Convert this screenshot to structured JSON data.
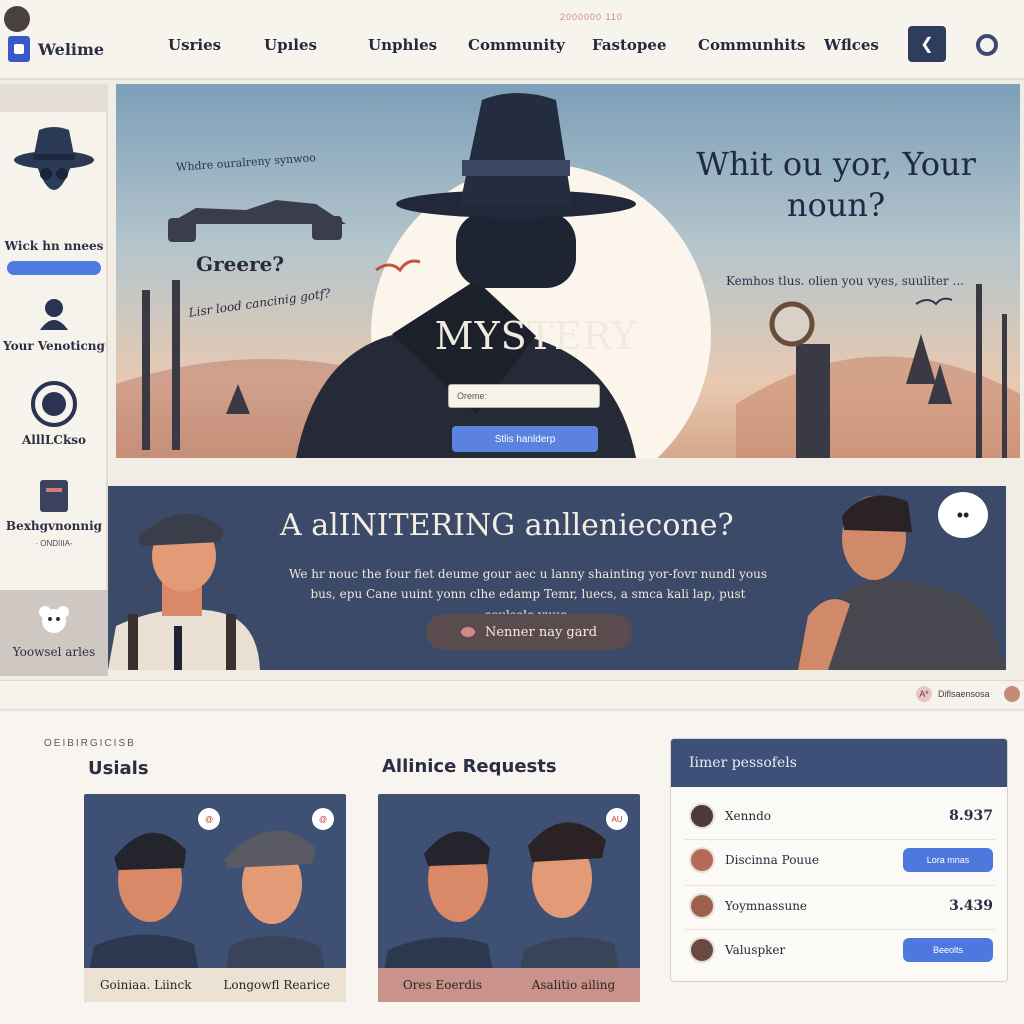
{
  "topbar": {
    "tiny_text": "2000000 110 ",
    "brand": "Welime",
    "links": [
      "Usries",
      "Upıles",
      "Unphles",
      "Community",
      "Fastopee",
      "Communhits",
      "Wflces"
    ],
    "action_icon": "chevron-left-icon",
    "globe_icon": "globe-icon"
  },
  "sidebar": {
    "items": [
      {
        "label": "Wick hn nnees",
        "icon": "detective-icon"
      },
      {
        "label": "Your Venoticng",
        "icon": "spy-icon"
      },
      {
        "label": "AlllLCkso",
        "icon": "badge-icon"
      },
      {
        "label": "Bexhgvnonnig",
        "sublabel": "· ONDIIIA-",
        "icon": "document-icon"
      },
      {
        "label": "Yoowsel arles",
        "icon": "bear-icon"
      }
    ]
  },
  "hero": {
    "arc_text": "Whdre ouralreny synwoo",
    "greeting": "Greere?",
    "sub_text": "Lisr lood cancinig gotf?",
    "title": "Whit ou yor, Your noun?",
    "small_text": "Kemhos tlus. olien you vyes, suuliter ...",
    "mystery": "MYSTERY",
    "input_placeholder": "Oreme:",
    "button": "Stlis hanlderp"
  },
  "banner": {
    "title": "A alINITERING anlleniecone?",
    "text": "We hr nouc the four fiet deume gour aec u lanny shainting yor-fovr nundl yous bus, epu Cane uuint yonn clhe edamp Temr, luecs, a smca kali lap, pust soulsele yuue.",
    "button": "Nenner nay gard",
    "bubble": "••"
  },
  "divider": {
    "chip_text": "Diflsaensosa",
    "chip_badge": "A*"
  },
  "lower": {
    "breadcrumb": "OEIBIRGICISB",
    "col1_title": "Usials",
    "col2_title": "Allinice Requests",
    "card1": {
      "left": "Goiniaa. Liinck",
      "right": "Longowfl Rearice",
      "bubble": "@"
    },
    "card2": {
      "left": "Ores Eoerdis",
      "right": "Asalitio ailing",
      "bubble": "AU"
    },
    "panel": {
      "title": "Iimer pessofels",
      "rows": [
        {
          "name": "Xenndo",
          "value": "8.937"
        },
        {
          "name": "Discinna Pouue",
          "button": "Lora mnas"
        },
        {
          "name": "Yoymnassune",
          "value": "3.439"
        },
        {
          "name": "Valuspker",
          "button": "Beeolts"
        }
      ]
    }
  }
}
